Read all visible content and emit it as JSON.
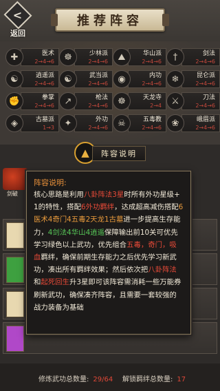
{
  "header": {
    "back_label": "返回",
    "title": "推荐阵容"
  },
  "schools": [
    {
      "name": "医术",
      "progress": "2→4→6",
      "icon": "medicine-icon",
      "col": 0,
      "row": 0
    },
    {
      "name": "少林派",
      "progress": "2→4→6",
      "icon": "shaolin-icon",
      "col": 1,
      "row": 0
    },
    {
      "name": "华山派",
      "progress": "2→4→6",
      "icon": "huashan-icon",
      "col": 2,
      "row": 0
    },
    {
      "name": "剑法",
      "progress": "2→4→6",
      "icon": "sword-icon",
      "col": 3,
      "row": 0
    },
    {
      "name": "逍遥派",
      "progress": "2→4→6",
      "icon": "xiaoyao-icon",
      "col": 0,
      "row": 1
    },
    {
      "name": "武当派",
      "progress": "2→4→6",
      "icon": "wudang-icon",
      "col": 1,
      "row": 1
    },
    {
      "name": "内功",
      "progress": "2→4→6",
      "icon": "inner-power-icon",
      "col": 2,
      "row": 1
    },
    {
      "name": "昆仑派",
      "progress": "2→4→6",
      "icon": "kunlun-icon",
      "col": 3,
      "row": 1
    },
    {
      "name": "拳掌",
      "progress": "2→4→6",
      "icon": "fist-icon",
      "col": 0,
      "row": 2
    },
    {
      "name": "枪法",
      "progress": "2→4→6",
      "icon": "spear-icon",
      "col": 1,
      "row": 2
    },
    {
      "name": "天龙寺",
      "progress": "2→4",
      "icon": "tianlong-icon",
      "col": 2,
      "row": 2
    },
    {
      "name": "刀法",
      "progress": "2→4→6",
      "icon": "blade-icon",
      "col": 3,
      "row": 2
    },
    {
      "name": "古墓派",
      "progress": "1→3",
      "icon": "gumu-icon",
      "col": 0,
      "row": 3
    },
    {
      "name": "外功",
      "progress": "2→4→6",
      "icon": "outer-power-icon",
      "col": 1,
      "row": 3
    },
    {
      "name": "五毒教",
      "progress": "2→4→6",
      "icon": "wudu-icon",
      "col": 2,
      "row": 3
    },
    {
      "name": "峨眉派",
      "progress": "2→4→6",
      "icon": "emei-icon",
      "col": 3,
      "row": 3
    }
  ],
  "lineup": {
    "title": "阵容说明",
    "sidebar_label": "剑破"
  },
  "popup": {
    "title": "阵容说明:",
    "segments": [
      {
        "t": "核心思路是利用",
        "c": ""
      },
      {
        "t": "八卦阵法3星",
        "c": "red"
      },
      {
        "t": "时所有外功星级+1的特性，搭配",
        "c": ""
      },
      {
        "t": "6外功羁绊",
        "c": "red"
      },
      {
        "t": "，达成超高减伤搭配",
        "c": ""
      },
      {
        "t": "6医术4奇门4五毒2天龙1古墓",
        "c": "orange"
      },
      {
        "t": "进一步提高生存能力，",
        "c": ""
      },
      {
        "t": "4剑法4华山4逍遥",
        "c": "green"
      },
      {
        "t": "保障输出前10关可优先学习绿色以上武功，优先组合",
        "c": ""
      },
      {
        "t": "五毒，奇门，吸血",
        "c": "red"
      },
      {
        "t": "羁绊，确保前期生存能力之后优先学习新武功，凑出所有羁绊效果；然后依次把",
        "c": ""
      },
      {
        "t": "八卦阵法",
        "c": "red"
      },
      {
        "t": "和",
        "c": ""
      },
      {
        "t": "起死回生",
        "c": "red"
      },
      {
        "t": "升3星即可该阵容需消耗一些万能券刷新武功，确保凑齐阵容，且需要一套较强的战力装备为基础",
        "c": ""
      }
    ]
  },
  "footer": {
    "trained_label": "修炼武功总数量:",
    "trained_value": "29/64",
    "unlock_label": "解锁羁绊总数量:",
    "unlock_value": "17"
  }
}
